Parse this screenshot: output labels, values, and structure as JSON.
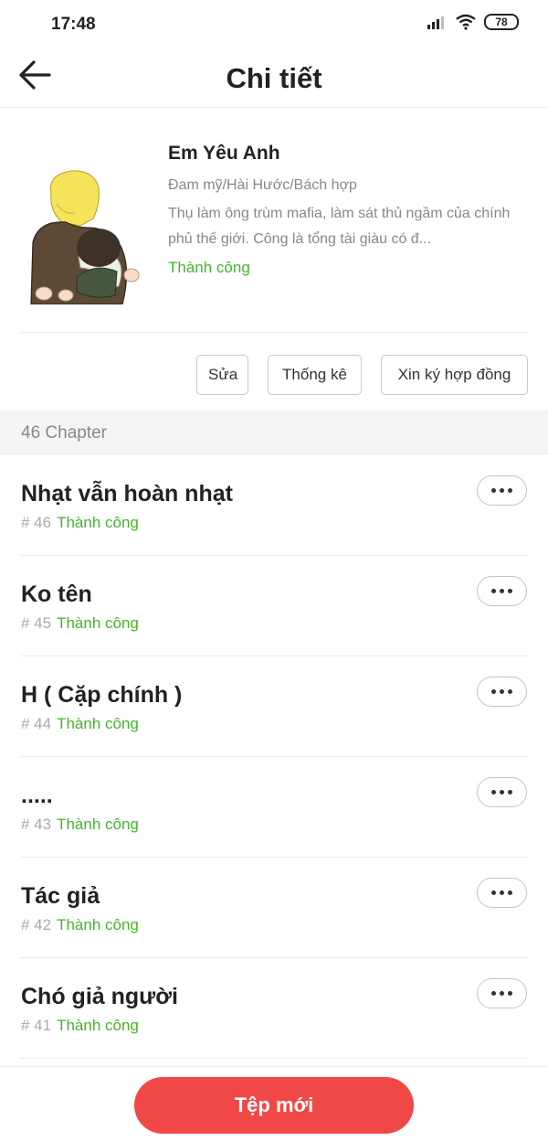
{
  "status_bar": {
    "time": "17:48",
    "battery": "78"
  },
  "header": {
    "title": "Chi tiết"
  },
  "book": {
    "title": "Em Yêu Anh",
    "genre": "Đam mỹ/Hài Hước/Bách hợp",
    "description": "Thụ làm ông trùm mafia, làm sát thủ ngầm của chính phủ thế giới. Công là tổng tài giàu có đ...",
    "status": "Thành công"
  },
  "actions": {
    "edit": "Sửa",
    "stats": "Thống kê",
    "contract": "Xin ký hợp đồng"
  },
  "chapter_section": {
    "count_label": "46 Chapter"
  },
  "chapters": [
    {
      "title": "Nhạt vẫn hoàn nhạt",
      "number": "# 46",
      "status": "Thành công"
    },
    {
      "title": "Ko tên",
      "number": "# 45",
      "status": "Thành công"
    },
    {
      "title": "H ( Cặp chính )",
      "number": "# 44",
      "status": "Thành công"
    },
    {
      "title": ".....",
      "number": "# 43",
      "status": "Thành công"
    },
    {
      "title": "Tác giả",
      "number": "# 42",
      "status": "Thành công"
    },
    {
      "title": "Chó giả người",
      "number": "# 41",
      "status": "Thành công"
    }
  ],
  "footer": {
    "new_button": "Tệp mới"
  },
  "colors": {
    "accent_red": "#f04747",
    "status_green": "#44b52a"
  },
  "icons": {
    "back": "arrow-left-icon",
    "more": "more-dots-icon",
    "signal": "signal-icon",
    "wifi": "wifi-icon",
    "battery": "battery-icon"
  }
}
